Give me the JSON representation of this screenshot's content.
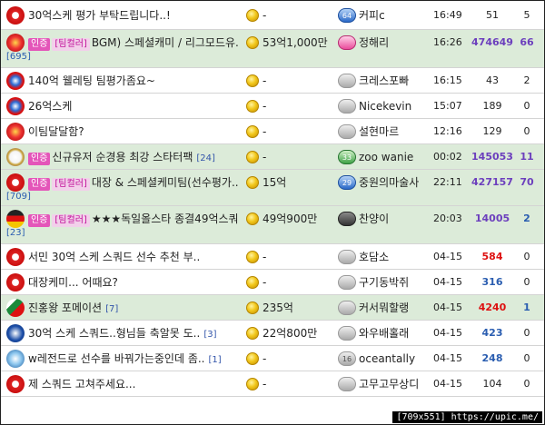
{
  "rows": [
    {
      "title": "30억스케 평가 부탁드립니다..!",
      "tags": [],
      "count": "",
      "count_below": "",
      "price": "-",
      "level": "64",
      "level_color": "blue",
      "user": "커피c",
      "time": "16:49",
      "views": "51",
      "views_style": "",
      "rec": "5",
      "rec_style": "",
      "highlight": false,
      "emblem": "arsenal"
    },
    {
      "title": "BGM) 스페셜캐미 / 리그모드유..",
      "tags": [
        "인증",
        "[팀컬러]"
      ],
      "count": "",
      "count_below": "[695]",
      "price": "53억1,000만",
      "level": "",
      "level_color": "pink",
      "user": "정해리",
      "time": "16:26",
      "views": "474649",
      "views_style": "purple",
      "rec": "66",
      "rec_style": "purple",
      "highlight": true,
      "emblem": "manutd"
    },
    {
      "title": "140억 웰레팅 팀평가좀요~",
      "tags": [],
      "count": "",
      "count_below": "",
      "price": "-",
      "level": "",
      "level_color": "gray",
      "user": "크레스포빠",
      "time": "16:15",
      "views": "43",
      "views_style": "",
      "rec": "2",
      "rec_style": "",
      "highlight": false,
      "emblem": "bayern"
    },
    {
      "title": "26억스케",
      "tags": [],
      "count": "",
      "count_below": "",
      "price": "-",
      "level": "",
      "level_color": "gray",
      "user": "Nicekevin",
      "time": "15:07",
      "views": "189",
      "views_style": "",
      "rec": "0",
      "rec_style": "",
      "highlight": false,
      "emblem": "bayern"
    },
    {
      "title": "이팀달달함?",
      "tags": [],
      "count": "",
      "count_below": "",
      "price": "-",
      "level": "",
      "level_color": "gray",
      "user": "설현마르",
      "time": "12:16",
      "views": "129",
      "views_style": "",
      "rec": "0",
      "rec_style": "",
      "highlight": false,
      "emblem": "manutd"
    },
    {
      "title": "신규유저 순경용 최강 스타터팩",
      "tags": [
        "인증"
      ],
      "count": "[24]",
      "count_below": "",
      "price": "-",
      "level": "33",
      "level_color": "green",
      "user": "zoo wanie",
      "time": "00:02",
      "views": "145053",
      "views_style": "purple",
      "rec": "11",
      "rec_style": "purple",
      "highlight": true,
      "emblem": "realmadrid"
    },
    {
      "title": "대장 & 스페셜케미팀(선수평가..",
      "tags": [
        "인증",
        "[팀컬러]"
      ],
      "count": "",
      "count_below": "[709]",
      "price": "15억",
      "level": "29",
      "level_color": "blue",
      "user": "중원의마술사",
      "time": "22:11",
      "views": "427157",
      "views_style": "purple",
      "rec": "70",
      "rec_style": "purple",
      "highlight": true,
      "emblem": "arsenal"
    },
    {
      "title": "★★★독일올스타 종결49억스쿼..",
      "tags": [
        "인증",
        "[팀컬러]"
      ],
      "count": "",
      "count_below": "[23]",
      "price": "49억900만",
      "level": "",
      "level_color": "dark",
      "user": "찬양이",
      "time": "20:03",
      "views": "14005",
      "views_style": "purple",
      "rec": "2",
      "rec_style": "blue",
      "highlight": true,
      "emblem": "germany"
    },
    {
      "title": "서민 30억 스케 스쿼드 선수 추천 부..",
      "tags": [],
      "count": "",
      "count_below": "",
      "price": "-",
      "level": "",
      "level_color": "gray",
      "user": "호담소",
      "time": "04-15",
      "views": "584",
      "views_style": "red",
      "rec": "0",
      "rec_style": "",
      "highlight": false,
      "emblem": "arsenal"
    },
    {
      "title": "대장케미... 어때요?",
      "tags": [],
      "count": "",
      "count_below": "",
      "price": "-",
      "level": "",
      "level_color": "gray",
      "user": "구기동박쥐",
      "time": "04-15",
      "views": "316",
      "views_style": "blue",
      "rec": "0",
      "rec_style": "",
      "highlight": false,
      "emblem": "arsenal"
    },
    {
      "title": "진홍왕 포메이션",
      "tags": [],
      "count": "[7]",
      "count_below": "",
      "price": "235억",
      "level": "",
      "level_color": "gray",
      "user": "커서뭐할랭",
      "time": "04-15",
      "views": "4240",
      "views_style": "red",
      "rec": "1",
      "rec_style": "blue",
      "highlight": true,
      "emblem": "legia"
    },
    {
      "title": "30억 스케 스쿼드..형님들 축알못 도..",
      "tags": [],
      "count": "[3]",
      "count_below": "",
      "price": "22억800만",
      "level": "",
      "level_color": "gray",
      "user": "와우배홀래",
      "time": "04-15",
      "views": "423",
      "views_style": "blue",
      "rec": "0",
      "rec_style": "",
      "highlight": false,
      "emblem": "everton"
    },
    {
      "title": "w레전드로 선수를 바꿔가는중인데 좀..",
      "tags": [],
      "count": "[1]",
      "count_below": "",
      "price": "-",
      "level": "16",
      "level_color": "gray",
      "user": "oceantally",
      "time": "04-15",
      "views": "248",
      "views_style": "blue",
      "rec": "0",
      "rec_style": "",
      "highlight": false,
      "emblem": "mancity"
    },
    {
      "title": "제 스쿼드 고쳐주세요...",
      "tags": [],
      "count": "",
      "count_below": "",
      "price": "-",
      "level": "",
      "level_color": "gray",
      "user": "고무고무상디",
      "time": "04-15",
      "views": "104",
      "views_style": "",
      "rec": "0",
      "rec_style": "",
      "highlight": false,
      "emblem": "arsenal"
    }
  ],
  "watermark": "[709x551] https://upic.me/"
}
